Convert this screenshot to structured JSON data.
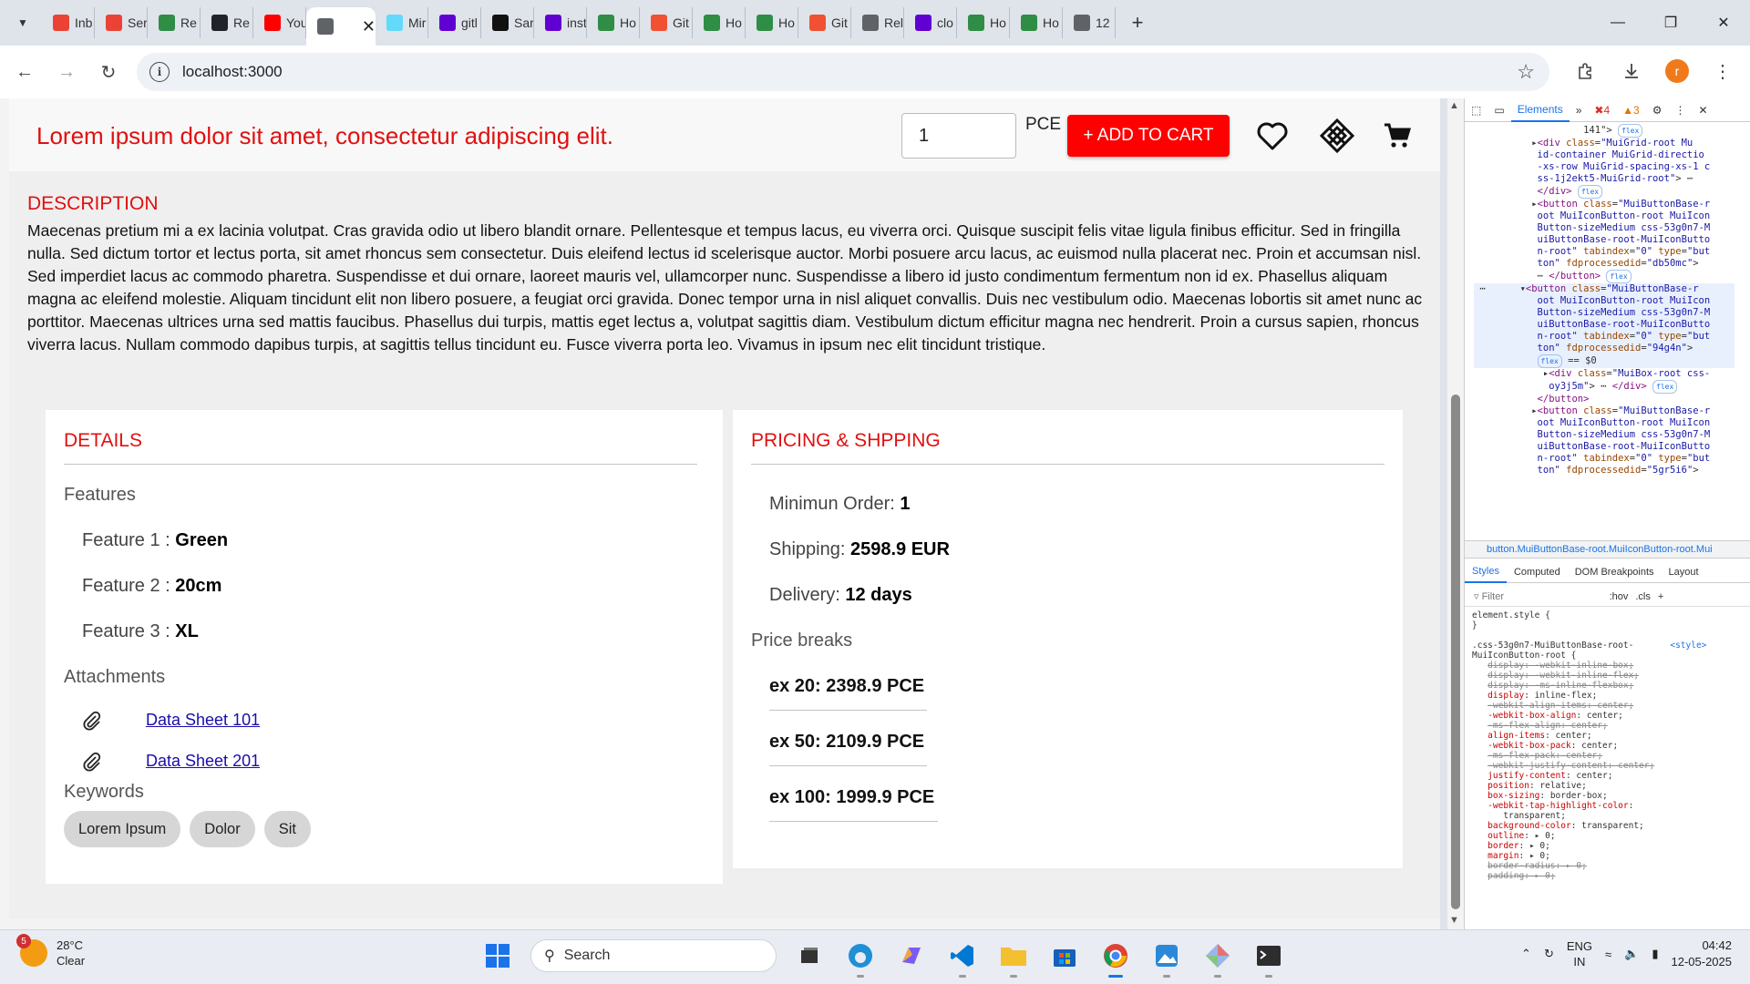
{
  "browser": {
    "tabs": [
      {
        "title": "Inb",
        "icon": "gmail-icon",
        "color": "#ea4335"
      },
      {
        "title": "Ser",
        "icon": "gmail-icon",
        "color": "#ea4335"
      },
      {
        "title": "Re",
        "icon": "geeksforgeeks-icon",
        "color": "#2f8d46"
      },
      {
        "title": "Re",
        "icon": "react-icon",
        "color": "#20232a"
      },
      {
        "title": "You",
        "icon": "youtube-icon",
        "color": "#ff0000"
      },
      {
        "title": "",
        "icon": "globe-icon",
        "color": "#5f6368",
        "active": true
      },
      {
        "title": "Mir",
        "icon": "react-icon",
        "color": "#61dafb"
      },
      {
        "title": "gitl",
        "icon": "yahoo-icon",
        "color": "#6001d2"
      },
      {
        "title": "Sar",
        "icon": "github-icon",
        "color": "#111111"
      },
      {
        "title": "inst",
        "icon": "yahoo-icon",
        "color": "#6001d2"
      },
      {
        "title": "Ho",
        "icon": "geeksforgeeks-icon",
        "color": "#2f8d46"
      },
      {
        "title": "Git",
        "icon": "git-icon",
        "color": "#f05133"
      },
      {
        "title": "Ho",
        "icon": "geeksforgeeks-icon",
        "color": "#2f8d46"
      },
      {
        "title": "Ho",
        "icon": "geeksforgeeks-icon",
        "color": "#2f8d46"
      },
      {
        "title": "Git",
        "icon": "git-icon",
        "color": "#f05133"
      },
      {
        "title": "Rel",
        "icon": "globe-icon",
        "color": "#5f6368"
      },
      {
        "title": "clo",
        "icon": "yahoo-icon",
        "color": "#6001d2"
      },
      {
        "title": "Ho",
        "icon": "geeksforgeeks-icon",
        "color": "#2f8d46"
      },
      {
        "title": "Ho",
        "icon": "geeksforgeeks-icon",
        "color": "#2f8d46"
      },
      {
        "title": "12",
        "icon": "globe-icon",
        "color": "#5f6368"
      }
    ],
    "url": "localhost:3000",
    "profile_initial": "r"
  },
  "product": {
    "title": "Lorem ipsum dolor sit amet, consectetur adipiscing elit.",
    "quantity": "1",
    "unit": "PCE",
    "add_to_cart": "+ ADD TO CART",
    "accent": "#ff0000"
  },
  "description": {
    "heading": "DESCRIPTION",
    "text": "Maecenas pretium mi a ex lacinia volutpat. Cras gravida odio ut libero blandit ornare. Pellentesque et tempus lacus, eu viverra orci. Quisque suscipit felis vitae ligula finibus efficitur. Sed in fringilla nulla. Sed dictum tortor et lectus porta, sit amet rhoncus sem consectetur. Duis eleifend lectus id scelerisque auctor. Morbi posuere arcu lacus, ac euismod nulla placerat nec. Proin et accumsan nisl. Sed imperdiet lacus ac commodo pharetra. Suspendisse et dui ornare, laoreet mauris vel, ullamcorper nunc. Suspendisse a libero id justo condimentum fermentum non id ex. Phasellus aliquam magna ac eleifend molestie. Aliquam tincidunt elit non libero posuere, a feugiat orci gravida. Donec tempor urna in nisl aliquet convallis. Duis nec vestibulum odio. Maecenas lobortis sit amet nunc ac porttitor. Maecenas ultrices urna sed mattis faucibus. Phasellus dui turpis, mattis eget lectus a, volutpat sagittis diam. Vestibulum dictum efficitur magna nec hendrerit. Proin a cursus sapien, rhoncus viverra lacus. Nullam commodo dapibus turpis, at sagittis tellus tincidunt eu. Fusce viverra porta leo. Vivamus in ipsum nec elit tincidunt tristique."
  },
  "details": {
    "heading": "DETAILS",
    "features_label": "Features",
    "features": [
      {
        "label": "Feature 1",
        "value": "Green"
      },
      {
        "label": "Feature 2",
        "value": "20cm"
      },
      {
        "label": "Feature 3",
        "value": "XL"
      }
    ],
    "attachments_label": "Attachments",
    "attachments": [
      "Data Sheet 101",
      "Data Sheet 201"
    ],
    "keywords_label": "Keywords",
    "keywords": [
      "Lorem Ipsum",
      "Dolor",
      "Sit"
    ]
  },
  "pricing": {
    "heading": "PRICING & SHPPING",
    "min_order_label": "Minimun Order",
    "min_order": "1",
    "shipping_label": "Shipping",
    "shipping": "2598.9 EUR",
    "delivery_label": "Delivery",
    "delivery": "12 days",
    "price_breaks_label": "Price breaks",
    "price_breaks": [
      "ex 20: 2398.9 PCE",
      "ex 50: 2109.9 PCE",
      "ex 100: 1999.9 PCE"
    ]
  },
  "devtools": {
    "tabs": [
      "Elements"
    ],
    "errors": "4",
    "warnings": "3",
    "breadcrumb": "button.MuiButtonBase-root.MuiIconButton-root.Mui",
    "style_tabs": [
      "Styles",
      "Computed",
      "DOM Breakpoints",
      "Layout"
    ],
    "filter_placeholder": "Filter",
    "filter_hov": ":hov",
    "filter_cls": ".cls"
  },
  "taskbar": {
    "weather_badge": "5",
    "temperature": "28°C",
    "condition": "Clear",
    "search_placeholder": "Search",
    "lang_line1": "ENG",
    "lang_line2": "IN",
    "time": "04:42",
    "date": "12-05-2025"
  }
}
